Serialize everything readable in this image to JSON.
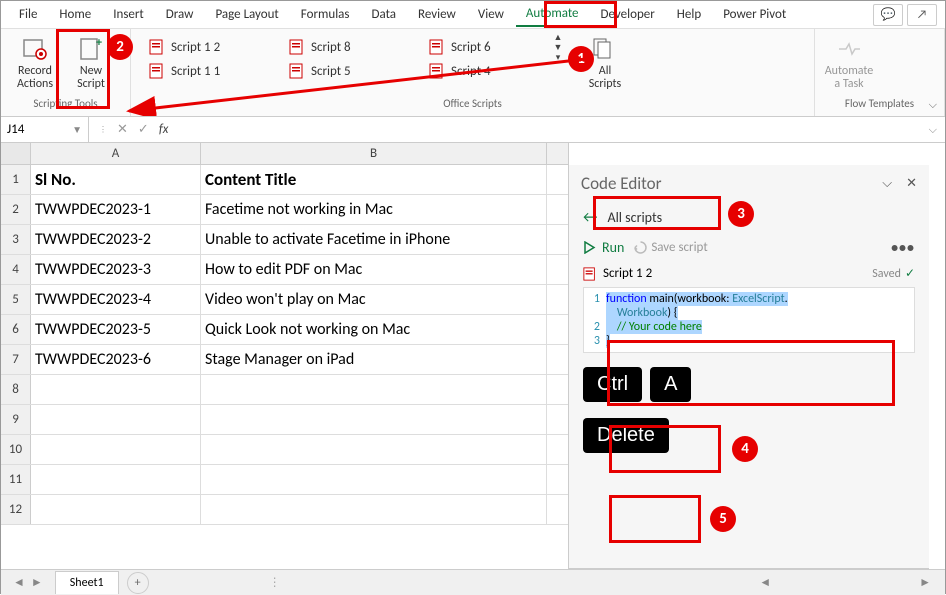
{
  "menu": {
    "items": [
      "File",
      "Home",
      "Insert",
      "Draw",
      "Page Layout",
      "Formulas",
      "Data",
      "Review",
      "View",
      "Automate",
      "Developer",
      "Help",
      "Power Pivot"
    ],
    "active": "Automate"
  },
  "ribbon": {
    "group1_label": "Scripting Tools",
    "record_label": "Record Actions",
    "new_script_label": "New Script",
    "group2_label": "Office Scripts",
    "scripts": [
      "Script 1 2",
      "Script 1 1",
      "Script 8",
      "Script 5",
      "Script 6",
      "Script 4"
    ],
    "all_scripts_label": "All Scripts",
    "automate_task_label": "Automate a Task",
    "group3_label": "Flow Templates"
  },
  "formula": {
    "cell_ref": "J14",
    "fx_label": "fx"
  },
  "grid": {
    "cols": [
      "A",
      "B"
    ],
    "header": [
      "Sl No.",
      "Content Title"
    ],
    "rows": [
      [
        "TWWPDEC2023-1",
        "Facetime not working in Mac"
      ],
      [
        "TWWPDEC2023-2",
        "Unable to activate Facetime in iPhone"
      ],
      [
        "TWWPDEC2023-3",
        "How to edit PDF on Mac"
      ],
      [
        "TWWPDEC2023-4",
        "Video won't play on Mac"
      ],
      [
        "TWWPDEC2023-5",
        "Quick Look not working on Mac"
      ],
      [
        "TWWPDEC2023-6",
        "Stage Manager on iPad"
      ]
    ],
    "row_numbers": [
      "1",
      "2",
      "3",
      "4",
      "5",
      "6",
      "7",
      "8",
      "9",
      "10",
      "11",
      "12"
    ]
  },
  "editor": {
    "title": "Code Editor",
    "all_scripts": "All scripts",
    "run": "Run",
    "save": "Save script",
    "script_name": "Script 1 2",
    "saved": "Saved",
    "code_lines": [
      {
        "n": "1",
        "html": "<span class='sel'><span class='kw'>function</span> main(workbook: <span class='ty'>ExcelScript</span>.</span>"
      },
      {
        "n": "",
        "html": "<span class='sel'>    <span class='ty'>Workbook</span>) {</span>"
      },
      {
        "n": "2",
        "html": "<span class='sel'>    <span class='cm'>// Your code here</span></span>"
      },
      {
        "n": "3",
        "html": "<span class='sel'>}</span>"
      }
    ]
  },
  "keys": {
    "ctrl": "Ctrl",
    "a": "A",
    "delete": "Delete"
  },
  "sheet": {
    "tab": "Sheet1"
  },
  "callouts": {
    "n1": "1",
    "n2": "2",
    "n3": "3",
    "n4": "4",
    "n5": "5"
  }
}
